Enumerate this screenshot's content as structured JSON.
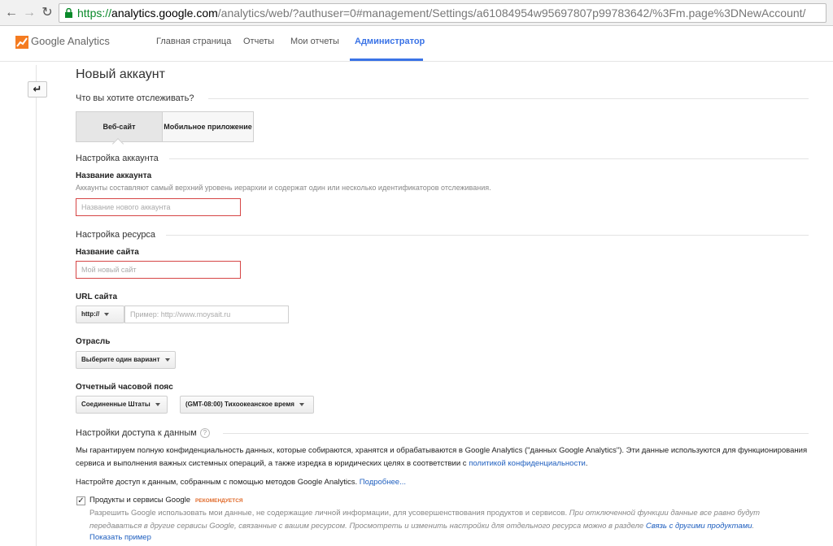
{
  "browser": {
    "url_scheme": "https://",
    "url_host": "analytics.google.com",
    "url_path": "/analytics/web/?authuser=0#management/Settings/a61084954w95697807p99783642/%3Fm.page%3DNewAccount/"
  },
  "header": {
    "app_name": "Google Analytics",
    "tabs": [
      "Главная страница",
      "Отчеты",
      "Мои отчеты",
      "Администратор"
    ],
    "active_tab": "Администратор",
    "accent_color": "#3a73e6"
  },
  "page": {
    "title": "Новый аккаунт",
    "track_question": "Что вы хотите отслеживать?",
    "track_options": [
      "Веб-сайт",
      "Мобильное приложение"
    ],
    "selected_option": "Веб-сайт"
  },
  "account": {
    "section": "Настройка аккаунта",
    "name_label": "Название аккаунта",
    "name_hint": "Аккаунты составляют самый верхний уровень иерархии и содержат один или несколько идентификаторов отслеживания.",
    "name_placeholder": "Название нового аккаунта"
  },
  "property": {
    "section": "Настройка ресурса",
    "site_name_label": "Название сайта",
    "site_name_placeholder": "Мой новый сайт",
    "url_label": "URL сайта",
    "protocol": "http://",
    "url_placeholder": "Пример: http://www.moysait.ru",
    "industry_label": "Отрасль",
    "industry_value": "Выберите один вариант",
    "timezone_label": "Отчетный часовой пояс",
    "country_value": "Соединенные Штаты",
    "timezone_value": "(GMT-08:00) Тихоокеанское время"
  },
  "data_sharing": {
    "section": "Настройки доступа к данным",
    "help": "?",
    "paragraph_main": "Мы гарантируем полную конфиденциальность данных, которые собираются, хранятся и обрабатываются в Google Analytics (\"данных Google Analytics\"). Эти данные используются для функционирования сервиса и выполнения важных системных операций, а также изредка в юридических целях в соответствии с ",
    "privacy_link": "политикой конфиденциальности",
    "paragraph_end": ".",
    "configure_text": "Настройте доступ к данным, собранным с помощью методов Google Analytics. ",
    "more_link": "Подробнее...",
    "checkbox_checked": true,
    "product_label": "Продукты и сервисы Google",
    "recommended": "РЕКОМЕНДУЕТСЯ",
    "product_desc": "Разрешить Google использовать мои данные, не содержащие личной информации, для усовершенствования продуктов и сервисов. ",
    "product_desc_italic": "При отключенной функции данные все равно будут передаваться в другие сервисы Google, связанные с вашим ресурсом. Просмотреть и изменить настройки для отдельного ресурса можно в разделе ",
    "products_link": "Связь с другими продуктами",
    "show_example": "Показать пример"
  }
}
